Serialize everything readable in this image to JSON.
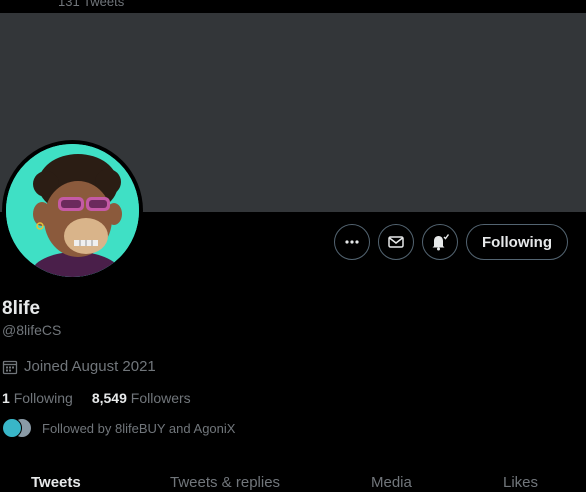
{
  "header": {
    "tweet_count": "131 Tweets"
  },
  "icons": {
    "more": "more-icon",
    "message": "mail-icon",
    "notifications": "bell-icon",
    "calendar": "calendar-icon"
  },
  "actions": {
    "follow_label": "Following"
  },
  "profile": {
    "name": "8life",
    "handle": "@8lifeCS",
    "joined": "Joined August 2021"
  },
  "stats": {
    "following_count": "1",
    "following_label": "Following",
    "followers_count": "8,549",
    "followers_label": "Followers"
  },
  "followed_by": {
    "text": "Followed by 8lifeBUY and AgoniX"
  },
  "tabs": [
    {
      "label": "Tweets",
      "active": true
    },
    {
      "label": "Tweets & replies",
      "active": false
    },
    {
      "label": "Media",
      "active": false
    },
    {
      "label": "Likes",
      "active": false
    }
  ],
  "colors": {
    "background": "#000000",
    "banner": "#333639",
    "avatar_bg": "#3fe0c5",
    "text_primary": "#e7e9ea",
    "text_secondary": "#71767b",
    "border": "#536471"
  }
}
